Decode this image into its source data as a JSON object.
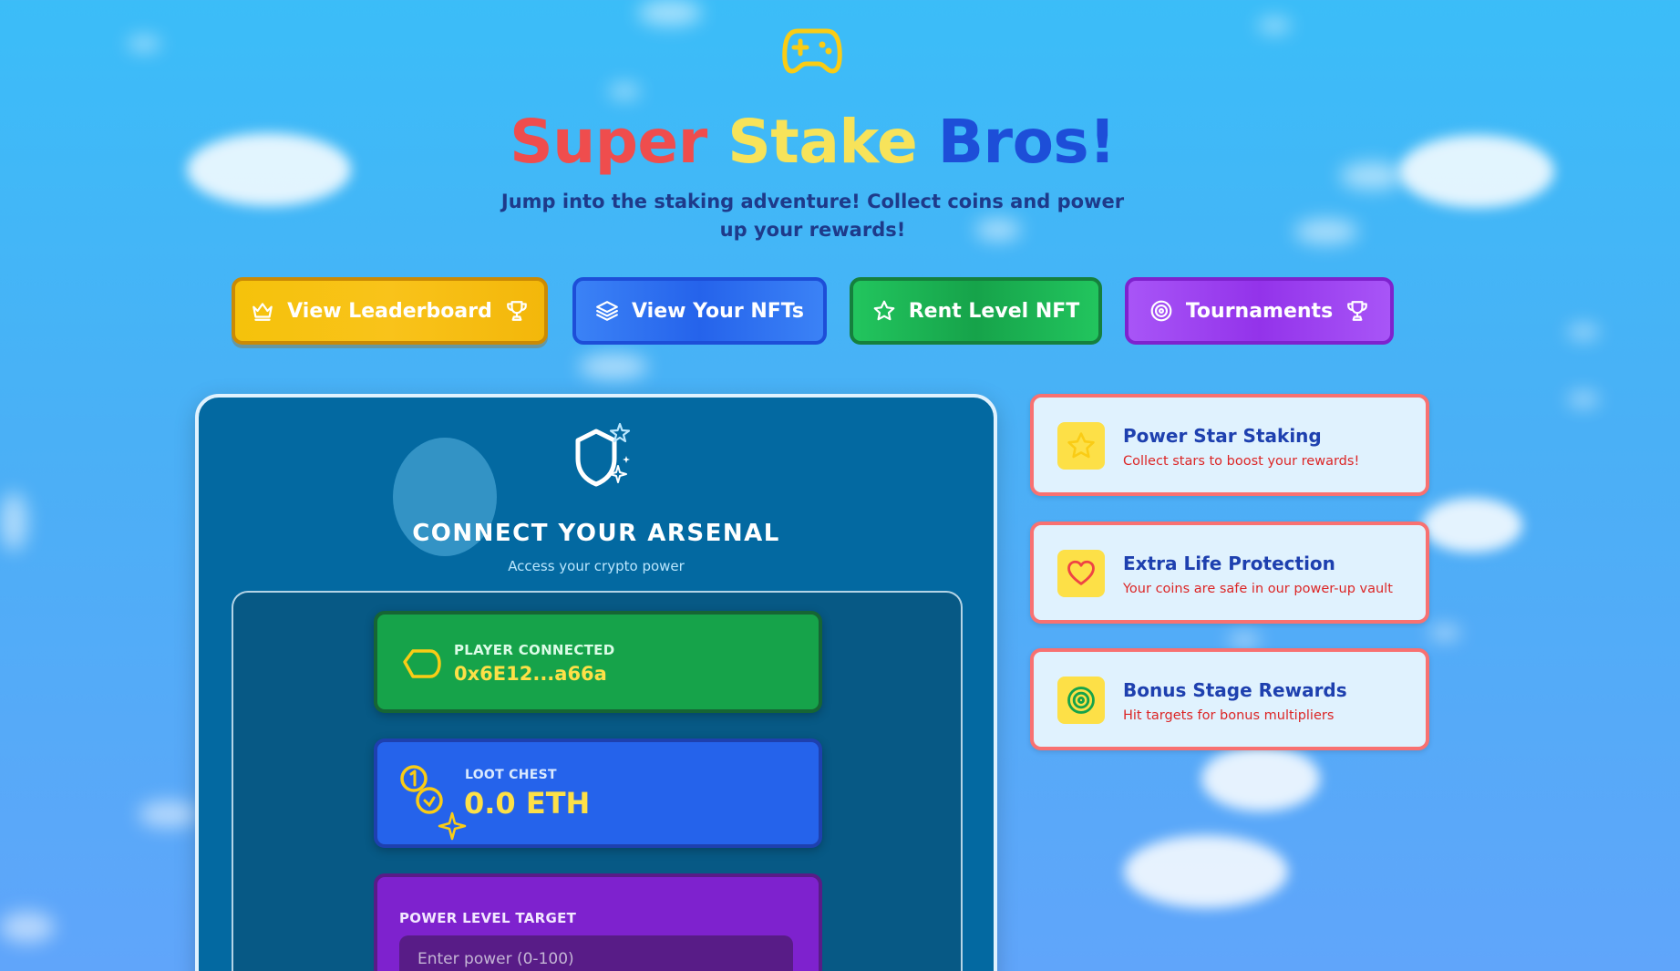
{
  "header": {
    "logo_icon": "gamepad-icon",
    "title_part1": "Super",
    "title_part2": "Stake",
    "title_part3": "Bros!",
    "subtitle": "Jump into the staking adventure! Collect coins and power up your rewards!"
  },
  "nav": [
    {
      "label": "View Leaderboard",
      "icon": "crown-icon",
      "trailing_icon": "trophy-icon",
      "color": "#f5c20b"
    },
    {
      "label": "View Your NFTs",
      "icon": "layers-icon",
      "color": "#2563eb"
    },
    {
      "label": "Rent Level NFT",
      "icon": "star-icon",
      "color": "#16a34a"
    },
    {
      "label": "Tournaments",
      "icon": "target-icon",
      "trailing_icon": "trophy-icon",
      "color": "#9333ea"
    }
  ],
  "arsenal": {
    "icon": "shield-sparkle-icon",
    "title": "CONNECT YOUR ARSENAL",
    "subtitle": "Access your crypto power",
    "player": {
      "icon": "wallet-icon",
      "label": "PLAYER CONNECTED",
      "address": "0x6E12...a66a"
    },
    "loot": {
      "icon": "coins-icon",
      "label": "LOOT CHEST",
      "value": "0.0 ETH"
    },
    "power": {
      "label": "POWER LEVEL TARGET",
      "placeholder": "Enter power (0-100)",
      "value": ""
    }
  },
  "features": [
    {
      "icon": "star-icon",
      "title": "Power Star Staking",
      "description": "Collect stars to boost your rewards!"
    },
    {
      "icon": "heart-icon",
      "title": "Extra Life Protection",
      "description": "Your coins are safe in our power-up vault"
    },
    {
      "icon": "target-icon",
      "title": "Bonus Stage Rewards",
      "description": "Hit targets for bonus multipliers"
    }
  ],
  "colors": {
    "sky": "#3bbdf8",
    "title_red": "#ef4d4d",
    "title_yellow": "#f7e35a",
    "title_blue": "#1d4ed8",
    "feature_border": "#f87171",
    "coin_yellow": "#fde047"
  }
}
